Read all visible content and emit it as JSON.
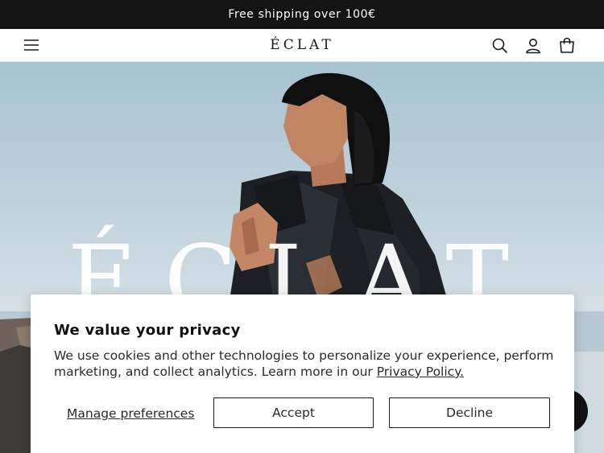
{
  "announcement": {
    "text": "Free shipping over 100€"
  },
  "header": {
    "logo": "ÉCLAT",
    "icons": [
      "menu-icon",
      "search-icon",
      "account-icon",
      "cart-icon"
    ]
  },
  "hero": {
    "brand_text": "ÉCLAT"
  },
  "cookie_banner": {
    "title": "We value your privacy",
    "body": "We use cookies and other technologies to personalize your experience, perform marketing, and collect analytics. Learn more in our ",
    "policy_link": "Privacy Policy.",
    "manage_label": "Manage preferences",
    "accept_label": "Accept",
    "decline_label": "Decline"
  },
  "colors": {
    "announcement_bg": "#141414",
    "text_dark": "#1a1a1a",
    "sky": "#bed1db",
    "jacket": "#1c1f24"
  }
}
